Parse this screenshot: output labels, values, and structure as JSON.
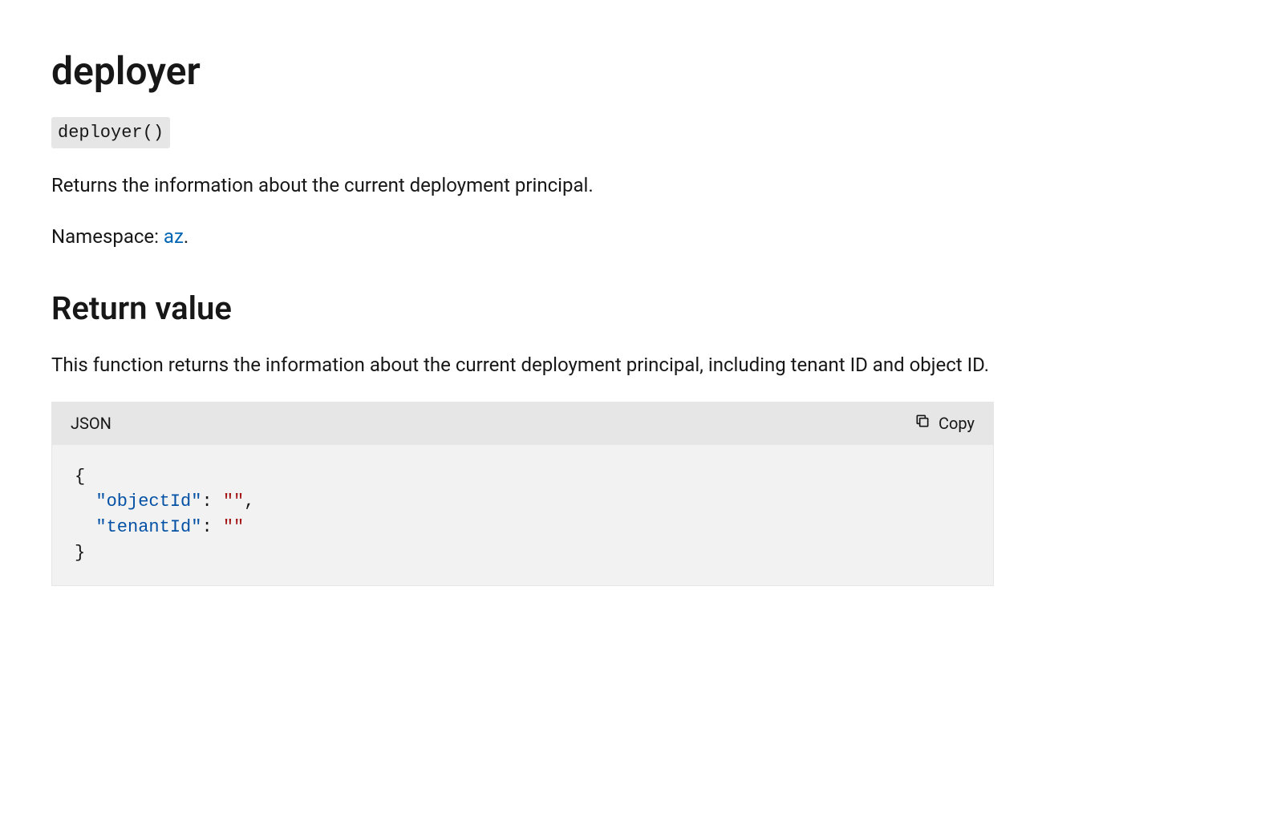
{
  "heading": "deployer",
  "signature": "deployer()",
  "description": "Returns the information about the current deployment principal.",
  "namespaceLabel": "Namespace: ",
  "namespaceLink": "az",
  "namespaceSuffix": ".",
  "returnValue": {
    "heading": "Return value",
    "description": "This function returns the information about the current deployment principal, including tenant ID and object ID."
  },
  "codeBlock": {
    "language": "JSON",
    "copyLabel": "Copy",
    "tokens": {
      "openBrace": "{",
      "indent1": "  ",
      "key1": "\"objectId\"",
      "colon": ": ",
      "val1": "\"\"",
      "comma": ",",
      "key2": "\"tenantId\"",
      "val2": "\"\"",
      "closeBrace": "}"
    }
  }
}
